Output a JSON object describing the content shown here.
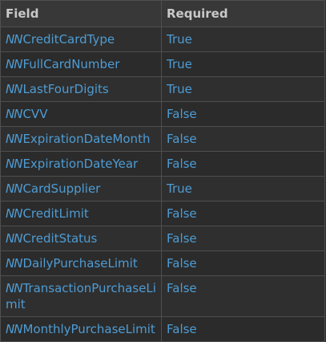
{
  "table": {
    "headers": {
      "field": "Field",
      "required": "Required"
    },
    "rows": [
      {
        "prefix": "NN",
        "name": "CreditCardType",
        "required": "True"
      },
      {
        "prefix": "NN",
        "name": "FullCardNumber",
        "required": "True"
      },
      {
        "prefix": "NN",
        "name": "LastFourDigits",
        "required": "True"
      },
      {
        "prefix": "NN",
        "name": "CVV",
        "required": "False"
      },
      {
        "prefix": "NN",
        "name": "ExpirationDateMonth",
        "required": "False"
      },
      {
        "prefix": "NN",
        "name": "ExpirationDateYear",
        "required": "False"
      },
      {
        "prefix": "NN",
        "name": "CardSupplier",
        "required": "True"
      },
      {
        "prefix": "NN",
        "name": "CreditLimit",
        "required": "False"
      },
      {
        "prefix": "NN",
        "name": "CreditStatus",
        "required": "False"
      },
      {
        "prefix": "NN",
        "name": "DailyPurchaseLimit",
        "required": "False"
      },
      {
        "prefix": "NN",
        "name": "TransactionPurchaseLimit",
        "required": "False"
      },
      {
        "prefix": "NN",
        "name": "MonthlyPurchaseLimit",
        "required": "False"
      }
    ]
  }
}
